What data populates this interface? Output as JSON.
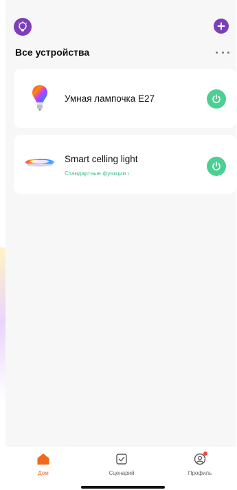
{
  "header": {
    "section_title": "Все устройства"
  },
  "icons": {
    "home_icon": "lightbulb-head-icon",
    "add": "plus-icon",
    "more": "more-dots-icon",
    "power": "power-icon",
    "tab_home": "house-icon",
    "tab_scenes": "checkbox-icon",
    "tab_profile": "user-icon"
  },
  "devices": [
    {
      "name": "Умная лампочка E27",
      "subtitle": "",
      "icon": "rgb-bulb-icon",
      "power_color": "#4ccf92"
    },
    {
      "name": "Smart celling light",
      "subtitle": "Стандартные функции ›",
      "icon": "ceiling-light-icon",
      "power_color": "#4ccf92"
    }
  ],
  "tabs": [
    {
      "label": "Дом",
      "active": true
    },
    {
      "label": "Сценарий",
      "active": false
    },
    {
      "label": "Профиль",
      "active": false
    }
  ],
  "colors": {
    "accent_purple": "#7b3fb8",
    "power_green": "#4ccf92",
    "active_tab": "#ef6a1f",
    "badge_red": "#f2453d"
  }
}
